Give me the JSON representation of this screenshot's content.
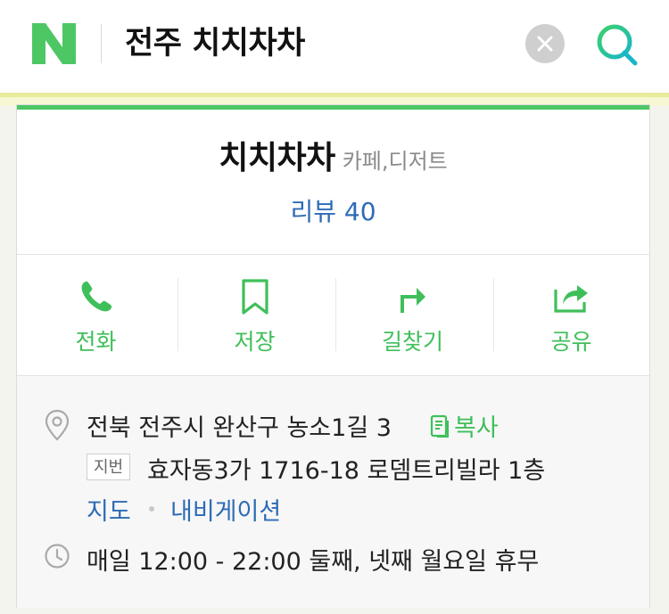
{
  "search": {
    "query": "전주 치치차차"
  },
  "place": {
    "name": "치치차차",
    "category": "카페,디저트",
    "review_label": "리뷰 40"
  },
  "actions": [
    {
      "label": "전화",
      "icon": "phone-icon"
    },
    {
      "label": "저장",
      "icon": "bookmark-icon"
    },
    {
      "label": "길찾기",
      "icon": "directions-icon"
    },
    {
      "label": "공유",
      "icon": "share-icon"
    }
  ],
  "info": {
    "address": "전북 전주시 완산구 농소1길 3",
    "copy_label": "복사",
    "jibun_badge": "지번",
    "jibun_address": "효자동3가 1716-18 로뎀트리빌라 1층",
    "map_link": "지도",
    "nav_link": "내비게이션",
    "hours": "매일 12:00 - 22:00 둘째, 넷째 월요일 휴무"
  },
  "colors": {
    "brand_green": "#4cc764",
    "link_blue": "#2d6bb5",
    "muted_gray": "#8a8a8a"
  }
}
